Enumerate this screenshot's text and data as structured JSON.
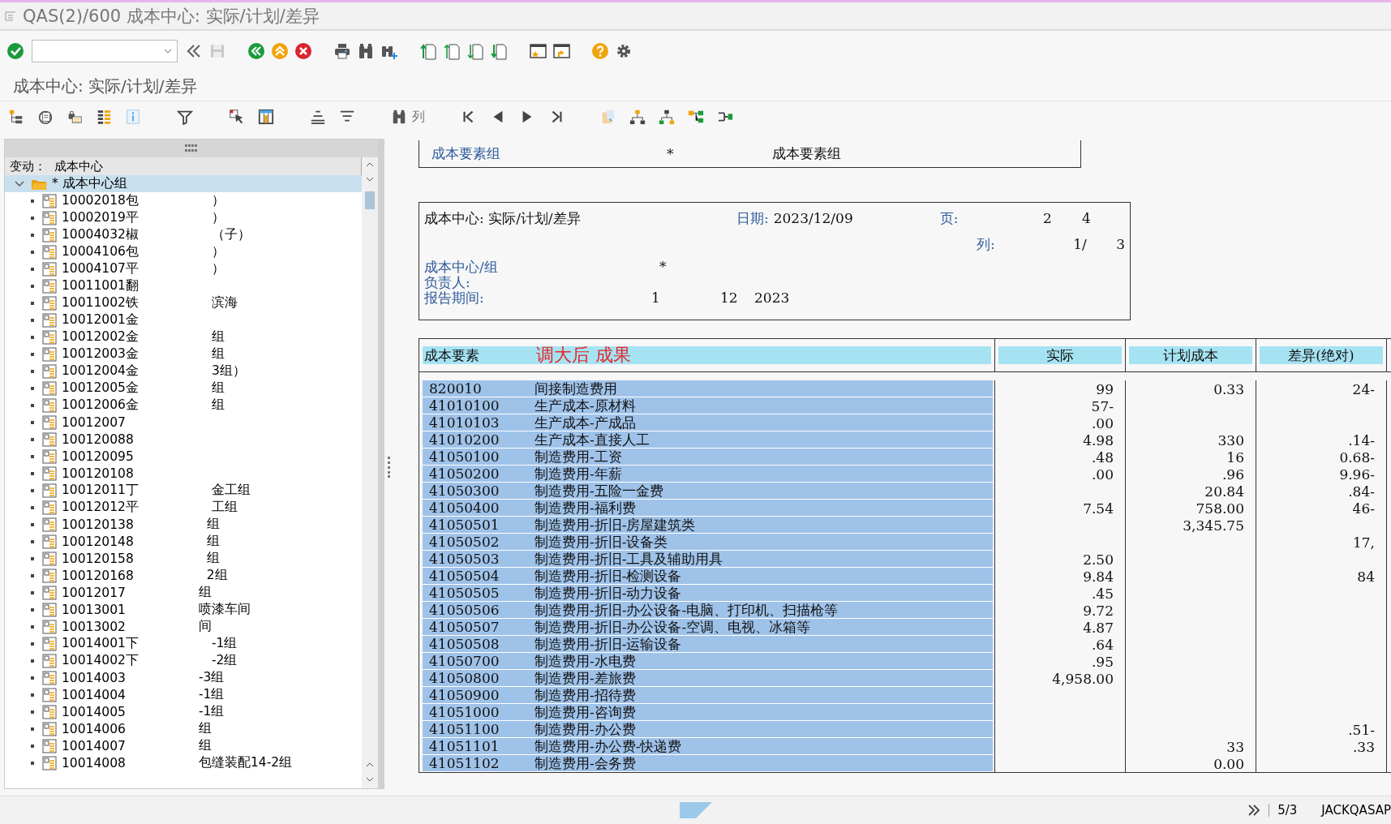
{
  "window": {
    "title": "QAS(2)/600 成本中心: 实际/计划/差异"
  },
  "screen_title": "成本中心: 实际/计划/差异",
  "app_toolbar": {
    "column_button": "列"
  },
  "tree": {
    "header_label": "变动：",
    "header_value": "成本中心",
    "root": {
      "label": "* 成本中心组",
      "expanded": true,
      "selected": true,
      "children": [
        {
          "code": "10002018",
          "name": "包",
          "tail": "）"
        },
        {
          "code": "10002019",
          "name": "平",
          "tail": "）"
        },
        {
          "code": "10004032",
          "name": "椒",
          "tail": "（子）"
        },
        {
          "code": "10004106",
          "name": "包",
          "tail": "）"
        },
        {
          "code": "10004107",
          "name": "平",
          "tail": "）"
        },
        {
          "code": "10011001",
          "name": "翻"
        },
        {
          "code": "10011002",
          "name": "铁",
          "tail": "滨海"
        },
        {
          "code": "10012001",
          "name": "金"
        },
        {
          "code": "10012002",
          "name": "金",
          "tail": "组"
        },
        {
          "code": "10012003",
          "name": "金",
          "tail": "组"
        },
        {
          "code": "10012004",
          "name": "金",
          "tail": "3组）"
        },
        {
          "code": "10012005",
          "name": "金",
          "tail": "组"
        },
        {
          "code": "10012006",
          "name": "金",
          "tail": "组"
        },
        {
          "code": "10012007"
        },
        {
          "code": "10012008",
          "name": "8"
        },
        {
          "code": "10012009",
          "name": "5"
        },
        {
          "code": "10012010",
          "name": "8"
        },
        {
          "code": "10012011",
          "name": "丁",
          "tail": "金工组"
        },
        {
          "code": "10012012",
          "name": "平",
          "tail": "工组"
        },
        {
          "code": "10012013",
          "name": "8",
          "tail": "组"
        },
        {
          "code": "10012014",
          "name": "8",
          "tail": "组"
        },
        {
          "code": "10012015",
          "name": "8",
          "tail": "组"
        },
        {
          "code": "10012016",
          "name": "8",
          "tail": "2组"
        },
        {
          "code": "10012017",
          "tail": "组"
        },
        {
          "code": "10013001",
          "tail": "喷漆车间"
        },
        {
          "code": "10013002",
          "tail": "间"
        },
        {
          "code": "10014001",
          "name": "下",
          "tail": "-1组"
        },
        {
          "code": "10014002",
          "name": "下",
          "tail": "-2组"
        },
        {
          "code": "10014003",
          "tail": "-3组"
        },
        {
          "code": "10014004",
          "tail": "-1组"
        },
        {
          "code": "10014005",
          "tail": "-1组"
        },
        {
          "code": "10014006",
          "tail": "组"
        },
        {
          "code": "10014007",
          "tail": "组"
        },
        {
          "code": "10014008",
          "tail": "包缝装配14-2组"
        }
      ]
    }
  },
  "report": {
    "selection": {
      "label": "成本要素组",
      "value": "*",
      "text": "成本要素组"
    },
    "header": {
      "title": "成本中心: 实际/计划/差异",
      "date_label": "日期:",
      "date": "2023/12/09",
      "page_label": "页:",
      "page": "2",
      "page_total": "4",
      "column_label": "列:",
      "column": "1/",
      "column_total": "3",
      "center_label": "成本中心/组",
      "center_value": "*",
      "owner_label": "负责人:",
      "period_label": "报告期间:",
      "period_from": "1",
      "period_to": "12",
      "year": "2023"
    },
    "annotation": "调大后 成果",
    "table": {
      "columns": [
        "成本要素",
        "实际",
        "计划成本",
        "差异(绝对)"
      ],
      "rows": [
        {
          "code": "820010",
          "text": "间接制造费用",
          "actual": "99",
          "plan": "0.33",
          "variance": "24-"
        },
        {
          "code": "41010100",
          "text": "生产成本-原材料",
          "actual": "57-"
        },
        {
          "code": "41010103",
          "text": "生产成本-产成品",
          "actual": ".00"
        },
        {
          "code": "41010200",
          "text": "生产成本-直接人工",
          "actual": "4.98",
          "plan": "330",
          "variance": ".14-"
        },
        {
          "code": "41050100",
          "text": "制造费用-工资",
          "actual": ".48",
          "plan": "16",
          "variance": "0.68-"
        },
        {
          "code": "41050200",
          "text": "制造费用-年薪",
          "actual": ".00",
          "plan": ".96",
          "variance": "9.96-"
        },
        {
          "code": "41050300",
          "text": "制造费用-五险一金费",
          "plan": "20.84",
          "variance": ".84-"
        },
        {
          "code": "41050400",
          "text": "制造费用-福利费",
          "actual": "7.54",
          "plan": "758.00",
          "variance": "46-"
        },
        {
          "code": "41050501",
          "text": "制造费用-折旧-房屋建筑类",
          "plan": "3,345.75"
        },
        {
          "code": "41050502",
          "text": "制造费用-折旧-设备类",
          "variance": "17,"
        },
        {
          "code": "41050503",
          "text": "制造费用-折旧-工具及辅助用具",
          "actual": "2.50"
        },
        {
          "code": "41050504",
          "text": "制造费用-折旧-检测设备",
          "actual": "9.84",
          "variance": "84"
        },
        {
          "code": "41050505",
          "text": "制造费用-折旧-动力设备",
          "actual": ".45"
        },
        {
          "code": "41050506",
          "text": "制造费用-折旧-办公设备-电脑、打印机、扫描枪等",
          "actual": "9.72"
        },
        {
          "code": "41050507",
          "text": "制造费用-折旧-办公设备-空调、电视、冰箱等",
          "actual": "4.87"
        },
        {
          "code": "41050508",
          "text": "制造费用-折旧-运输设备",
          "actual": ".64"
        },
        {
          "code": "41050700",
          "text": "制造费用-水电费",
          "actual": ".95"
        },
        {
          "code": "41050800",
          "text": "制造费用-差旅费",
          "actual": "4,958.00"
        },
        {
          "code": "41050900",
          "text": "制造费用-招待费"
        },
        {
          "code": "41051000",
          "text": "制造费用-咨询费"
        },
        {
          "code": "41051100",
          "text": "制造费用-办公费",
          "variance": ".51-"
        },
        {
          "code": "41051101",
          "text": "制造费用-办公费-快递费",
          "plan": "33",
          "variance": ".33"
        },
        {
          "code": "41051102",
          "text": "制造费用-会务费",
          "plan": "0.00"
        }
      ]
    }
  },
  "status_bar": {
    "session": "5/3",
    "system": "JACKQASAP"
  }
}
